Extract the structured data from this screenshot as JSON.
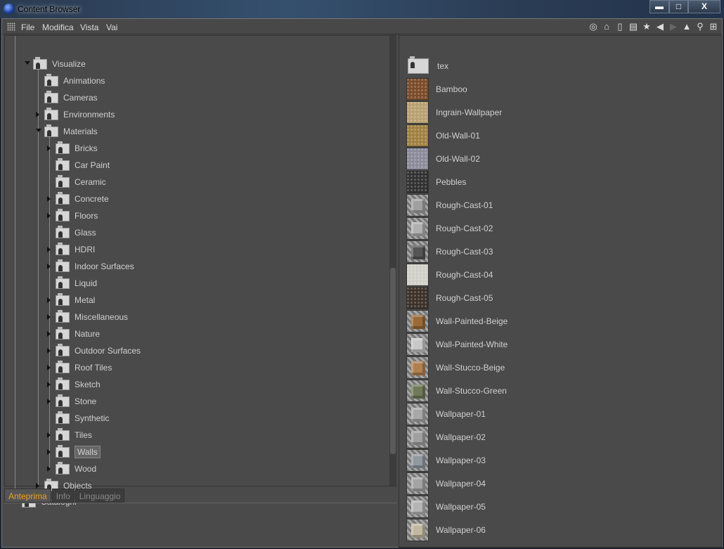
{
  "window": {
    "title": "Content Browser",
    "minimize": "▬",
    "maximize": "□",
    "close": "X"
  },
  "menu": [
    "File",
    "Modifica",
    "Vista",
    "Vai"
  ],
  "toolbar": [
    "preview-icon",
    "home-icon",
    "bin-icon",
    "book-icon",
    "star-icon",
    "back-icon",
    "forward-icon",
    "up-icon",
    "search-icon",
    "new-icon"
  ],
  "tree": {
    "visualize": "Visualize",
    "level2": [
      {
        "label": "Animations",
        "exp": false
      },
      {
        "label": "Cameras",
        "exp": false
      },
      {
        "label": "Environments",
        "exp": true
      },
      {
        "label": "Materials",
        "exp": true,
        "open": true
      }
    ],
    "materials": [
      {
        "label": "Bricks",
        "exp": true
      },
      {
        "label": "Car Paint",
        "exp": false
      },
      {
        "label": "Ceramic",
        "exp": false
      },
      {
        "label": "Concrete",
        "exp": true
      },
      {
        "label": "Floors",
        "exp": true
      },
      {
        "label": "Glass",
        "exp": false
      },
      {
        "label": "HDRI",
        "exp": true
      },
      {
        "label": "Indoor Surfaces",
        "exp": true
      },
      {
        "label": "Liquid",
        "exp": false
      },
      {
        "label": "Metal",
        "exp": true
      },
      {
        "label": "Miscellaneous",
        "exp": true
      },
      {
        "label": "Nature",
        "exp": true
      },
      {
        "label": "Outdoor Surfaces",
        "exp": true
      },
      {
        "label": "Roof Tiles",
        "exp": true
      },
      {
        "label": "Sketch",
        "exp": true
      },
      {
        "label": "Stone",
        "exp": true
      },
      {
        "label": "Synthetic",
        "exp": false
      },
      {
        "label": "Tiles",
        "exp": true
      },
      {
        "label": "Walls",
        "exp": true,
        "selected": true
      },
      {
        "label": "Wood",
        "exp": true
      }
    ],
    "objects": "Objects",
    "cataloghi": "Cataloghi"
  },
  "tabs": [
    {
      "label": "Anteprima",
      "active": true
    },
    {
      "label": "Info"
    },
    {
      "label": "Linguaggio"
    }
  ],
  "files": [
    {
      "name": "tex",
      "kind": "folder"
    },
    {
      "name": "Bamboo",
      "kind": "tex",
      "color": "#7a4a28"
    },
    {
      "name": "Ingrain-Wallpaper",
      "kind": "tex",
      "color": "#b8a070"
    },
    {
      "name": "Old-Wall-01",
      "kind": "tex",
      "color": "#a08040"
    },
    {
      "name": "Old-Wall-02",
      "kind": "tex",
      "color": "#8a8a9a"
    },
    {
      "name": "Pebbles",
      "kind": "tex",
      "color": "#303030"
    },
    {
      "name": "Rough-Cast-01",
      "kind": "cube",
      "color": "#a0a0a0"
    },
    {
      "name": "Rough-Cast-02",
      "kind": "cube",
      "color": "#b0b0b0"
    },
    {
      "name": "Rough-Cast-03",
      "kind": "cube",
      "color": "#555555"
    },
    {
      "name": "Rough-Cast-04",
      "kind": "tex",
      "color": "#d0d0c8"
    },
    {
      "name": "Rough-Cast-05",
      "kind": "tex",
      "color": "#3a3028"
    },
    {
      "name": "Wall-Painted-Beige",
      "kind": "cube",
      "color": "#9a6a38"
    },
    {
      "name": "Wall-Painted-White",
      "kind": "cube",
      "color": "#c8c8c8"
    },
    {
      "name": "Wall-Stucco-Beige",
      "kind": "cube",
      "color": "#b08050"
    },
    {
      "name": "Wall-Stucco-Green",
      "kind": "cube",
      "color": "#707a58"
    },
    {
      "name": "Wallpaper-01",
      "kind": "cube",
      "color": "#a8a8a8"
    },
    {
      "name": "Wallpaper-02",
      "kind": "cube",
      "color": "#a0a0a0"
    },
    {
      "name": "Wallpaper-03",
      "kind": "cube",
      "color": "#9098a0"
    },
    {
      "name": "Wallpaper-04",
      "kind": "cube",
      "color": "#a4a4a4"
    },
    {
      "name": "Wallpaper-05",
      "kind": "cube",
      "color": "#b4b4b4"
    },
    {
      "name": "Wallpaper-06",
      "kind": "cube",
      "color": "#c0b8a0"
    }
  ]
}
